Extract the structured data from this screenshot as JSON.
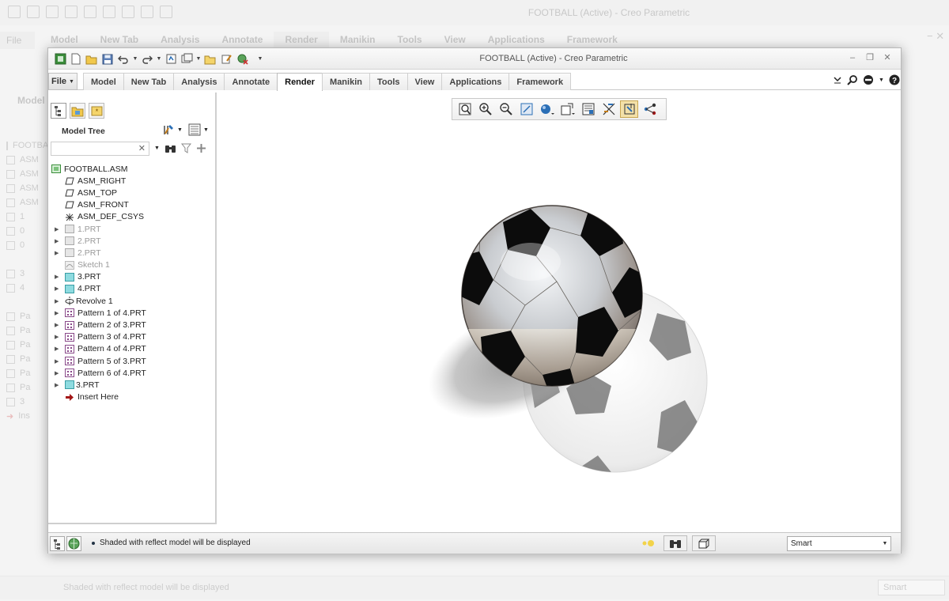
{
  "app": {
    "title": "FOOTBALL (Active) - Creo Parametric",
    "file_menu": "File",
    "tabs": [
      "Model",
      "New Tab",
      "Analysis",
      "Annotate",
      "Render",
      "Manikin",
      "Tools",
      "View",
      "Applications",
      "Framework"
    ],
    "active_tab": "Render"
  },
  "background_window": {
    "title": "FOOTBALL (Active) - Creo Parametric",
    "tabs": [
      "Model",
      "New Tab",
      "Analysis",
      "Annotate",
      "Render",
      "Manikin",
      "Tools",
      "View",
      "Applications",
      "Framework"
    ],
    "model_label": "Model",
    "tree_rows": [
      "FOOTBALL.ASM",
      "ASM",
      "ASM",
      "ASM",
      "ASM",
      "1",
      "0",
      "0",
      "3",
      "4",
      "Pa",
      "Pa",
      "Pa",
      "Pa",
      "Pa",
      "Pa",
      "3",
      "Ins"
    ],
    "status_message": "Shaded with reflect model will be displayed",
    "selection_filter": "Smart"
  },
  "model_tree": {
    "header": "Model Tree",
    "search_placeholder": "",
    "items": [
      {
        "label": "FOOTBALL.ASM",
        "icon": "assembly-icon",
        "dim": false
      },
      {
        "label": "ASM_RIGHT",
        "icon": "datum-plane-icon",
        "dim": false
      },
      {
        "label": "ASM_TOP",
        "icon": "datum-plane-icon",
        "dim": false
      },
      {
        "label": "ASM_FRONT",
        "icon": "datum-plane-icon",
        "dim": false
      },
      {
        "label": "ASM_DEF_CSYS",
        "icon": "csys-icon",
        "dim": false
      },
      {
        "label": "1.PRT",
        "icon": "part-icon",
        "dim": true
      },
      {
        "label": "2.PRT",
        "icon": "part-icon",
        "dim": true
      },
      {
        "label": "2.PRT",
        "icon": "part-icon",
        "dim": true
      },
      {
        "label": "Sketch 1",
        "icon": "sketch-icon",
        "dim": true
      },
      {
        "label": "3.PRT",
        "icon": "part-icon",
        "dim": false
      },
      {
        "label": "4.PRT",
        "icon": "part-icon",
        "dim": false
      },
      {
        "label": "Revolve 1",
        "icon": "revolve-icon",
        "dim": false
      },
      {
        "label": "Pattern 1 of 4.PRT",
        "icon": "pattern-icon",
        "dim": false
      },
      {
        "label": "Pattern 2 of 3.PRT",
        "icon": "pattern-icon",
        "dim": false
      },
      {
        "label": "Pattern 3 of 4.PRT",
        "icon": "pattern-icon",
        "dim": false
      },
      {
        "label": "Pattern 4 of 4.PRT",
        "icon": "pattern-icon",
        "dim": false
      },
      {
        "label": "Pattern 5 of 3.PRT",
        "icon": "pattern-icon",
        "dim": false
      },
      {
        "label": "Pattern 6 of 4.PRT",
        "icon": "pattern-icon",
        "dim": false
      },
      {
        "label": "3.PRT",
        "icon": "part-icon",
        "dim": false
      },
      {
        "label": "Insert Here",
        "icon": "insert-arrow-icon",
        "dim": false
      }
    ]
  },
  "view_toolbar": {
    "buttons": [
      "refit-icon",
      "zoom-in-icon",
      "zoom-out-icon",
      "repaint-icon",
      "display-style-icon",
      "saved-orientations-icon",
      "view-manager-icon",
      "datum-display-icon",
      "spin-center-icon",
      "annotation-display-icon"
    ]
  },
  "status": {
    "message": "Shaded with reflect model will be displayed",
    "selection_filter": "Smart"
  },
  "colors": {
    "accent": "#2b6fb6",
    "title_text": "#555555",
    "active_toggle": "#f3e0a8"
  }
}
